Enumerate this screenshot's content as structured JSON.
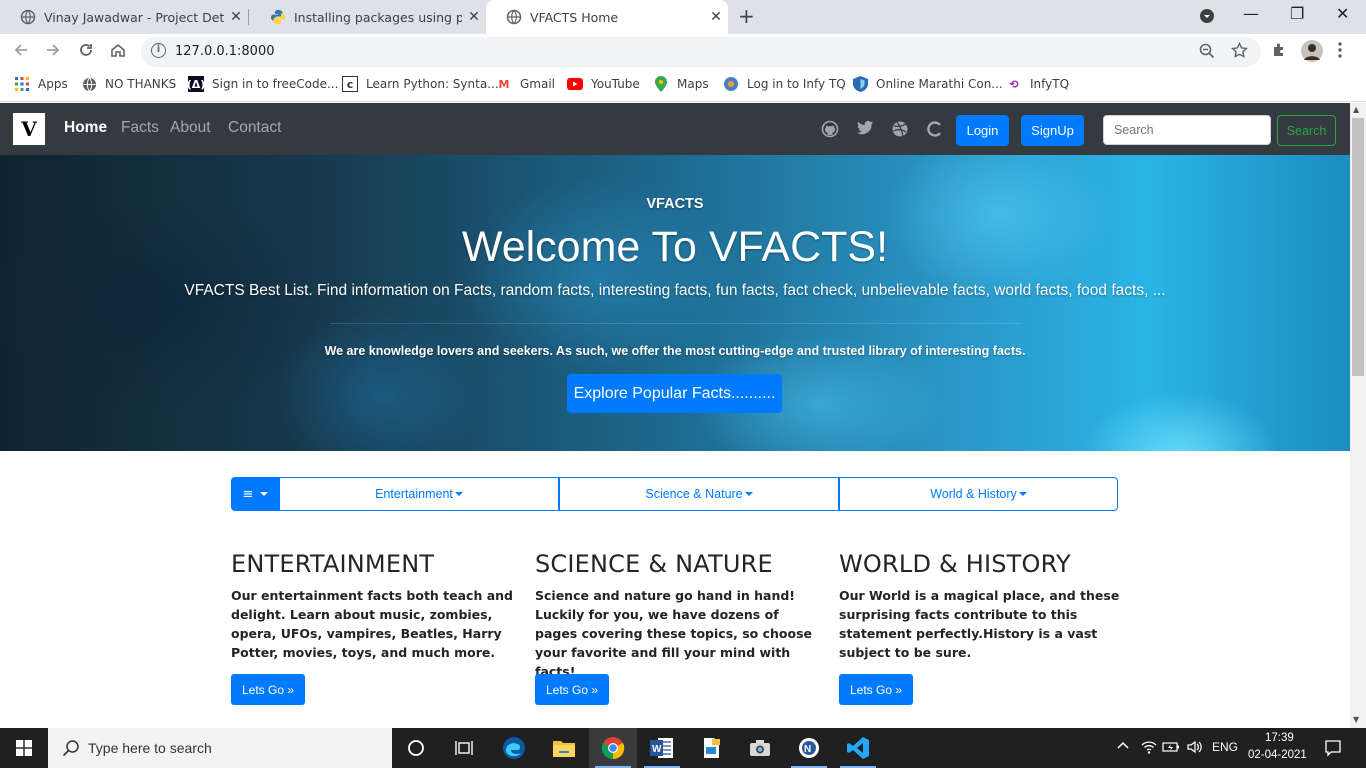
{
  "browser": {
    "tabs": [
      {
        "title": "Vinay Jawadwar - Project Detail",
        "active": false
      },
      {
        "title": "Installing packages using pip and",
        "active": false
      },
      {
        "title": "VFACTS Home",
        "active": true
      }
    ],
    "url": "127.0.0.1:8000",
    "bookmarks": [
      "Apps",
      "NO THANKS",
      "Sign in to freeCode...",
      "Learn Python: Synta...",
      "Gmail",
      "YouTube",
      "Maps",
      "Log in to Infy TQ",
      "Online Marathi Con...",
      "InfyTQ"
    ]
  },
  "navbar": {
    "brand_letter": "V",
    "links": [
      "Home",
      "Facts",
      "About",
      "Contact"
    ],
    "login_label": "Login",
    "signup_label": "SignUp",
    "search_placeholder": "Search",
    "search_button": "Search"
  },
  "hero": {
    "kicker": "VFACTS",
    "title": "Welcome To VFACTS!",
    "subtitle": "VFACTS Best List. Find information on Facts, random facts, interesting facts, fun facts, fact check, unbelievable facts, world facts, food facts, ...",
    "tagline": "We are knowledge lovers and seekers. As such, we offer the most cutting-edge and trusted library of interesting facts.",
    "button": "Explore Popular Facts.........."
  },
  "categories": {
    "menu_icon": "≡",
    "items": [
      "Entertainment",
      "Science & Nature",
      "World & History"
    ]
  },
  "cards": [
    {
      "title": "ENTERTAINMENT",
      "text": "Our entertainment facts both teach and delight. Learn about music, zombies, opera, UFOs, vampires, Beatles, Harry Potter, movies, toys, and much more.",
      "button": "Lets Go »"
    },
    {
      "title": "SCIENCE & NATURE",
      "text": "Science and nature go hand in hand! Luckily for you, we have dozens of pages covering these topics, so choose your favorite and fill your mind with facts!",
      "button": "Lets Go »"
    },
    {
      "title": "WORLD & HISTORY",
      "text": "Our World is a magical place, and these surprising facts contribute to this statement perfectly.History is a vast subject to be sure.",
      "button": "Lets Go »"
    }
  ],
  "taskbar": {
    "search_placeholder": "Type here to search",
    "lang": "ENG",
    "time": "17:39",
    "date": "02-04-2021"
  }
}
